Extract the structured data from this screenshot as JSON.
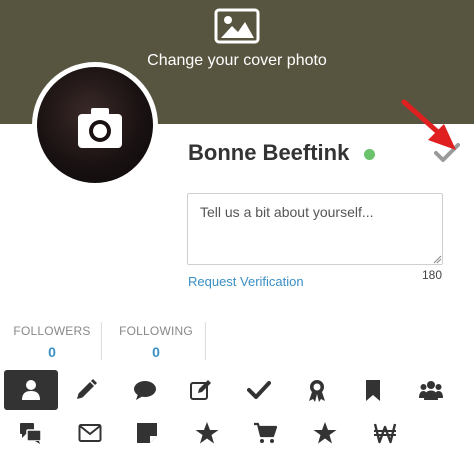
{
  "cover": {
    "label": "Change your cover photo",
    "icon": "image-icon"
  },
  "profile": {
    "avatar_icon": "camera-icon",
    "name": "Bonne Beeftink",
    "status_color": "#6ac36a",
    "verify_icon": "checkmark-icon",
    "annotation_icon": "red-arrow-icon"
  },
  "about": {
    "placeholder": "Tell us a bit about yourself...",
    "value": "",
    "char_count": "180"
  },
  "request_verification": "Request Verification",
  "stats": [
    {
      "label": "FOLLOWERS",
      "value": "0"
    },
    {
      "label": "FOLLOWING",
      "value": "0"
    }
  ],
  "tabs_row1": [
    "user-icon",
    "pencil-icon",
    "comment-icon",
    "edit-icon",
    "check-icon",
    "award-icon",
    "bookmark-icon",
    "users-icon"
  ],
  "tabs_row2": [
    "comments-icon",
    "envelope-icon",
    "sticky-note-icon",
    "star-icon",
    "cart-icon",
    "star-icon",
    "won-sign-icon"
  ],
  "colors": {
    "cover": "#57553f",
    "accent": "#3a8fc4",
    "active_tab": "#333333",
    "icon": "#333333"
  }
}
